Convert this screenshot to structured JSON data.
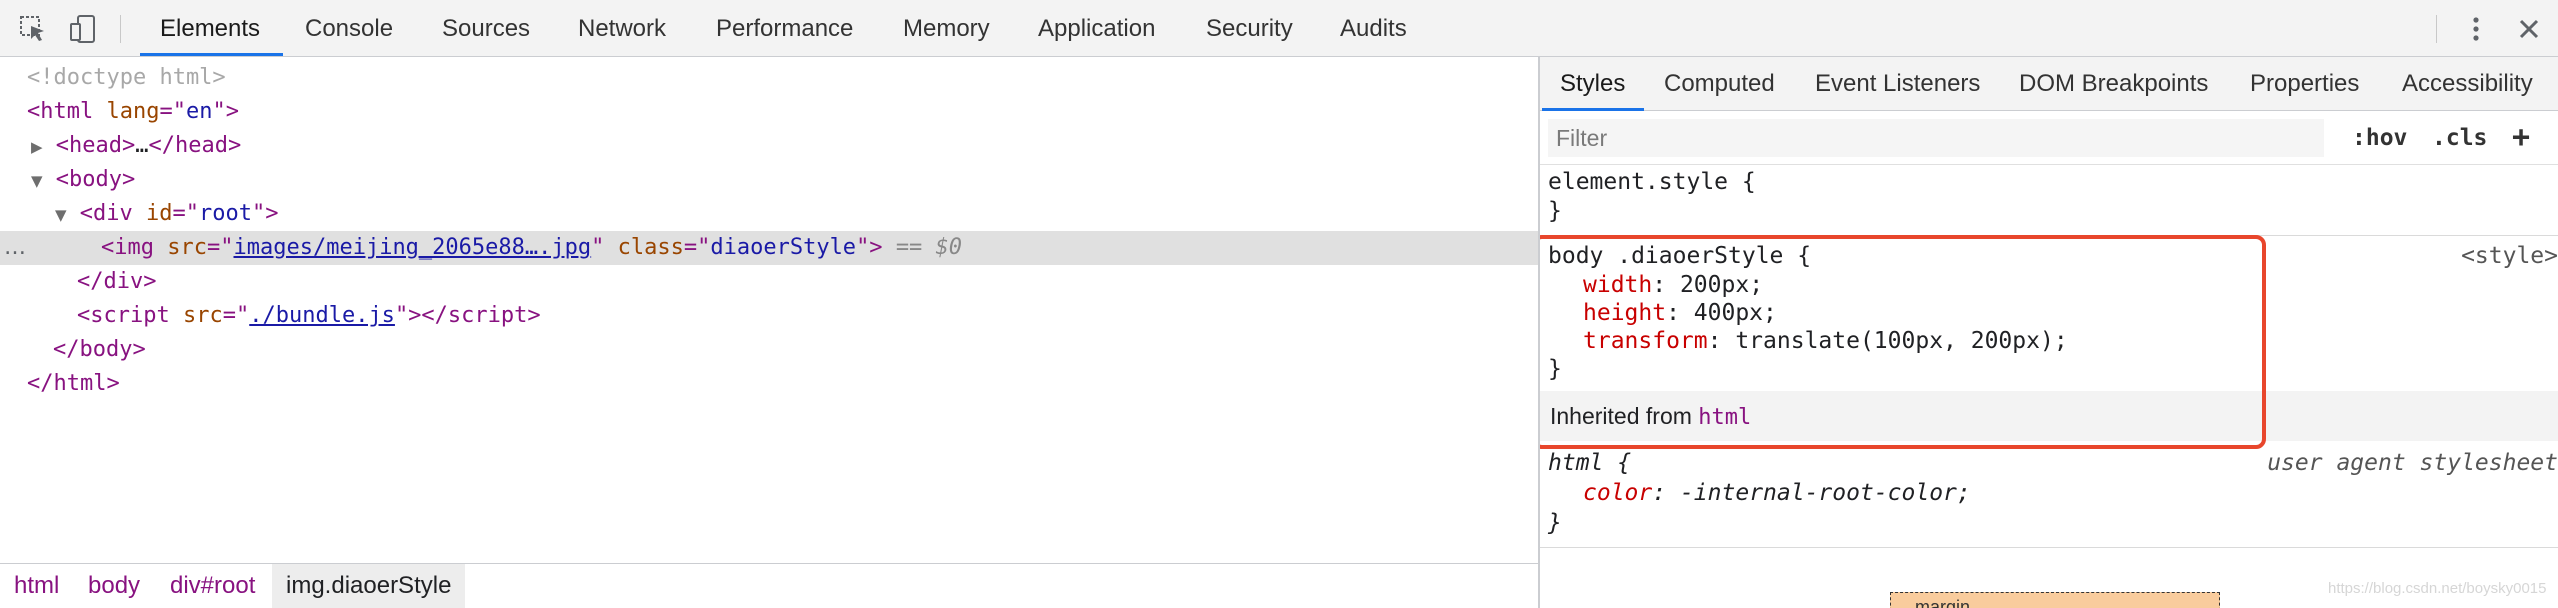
{
  "toolbar": {
    "tabs": [
      "Elements",
      "Console",
      "Sources",
      "Network",
      "Performance",
      "Memory",
      "Application",
      "Security",
      "Audits"
    ],
    "active_tab": "Elements",
    "left_icons": [
      "select-element-icon",
      "device-toolbar-icon"
    ],
    "right_icons": [
      "more-options-icon",
      "close-icon"
    ]
  },
  "dom": {
    "doctype": "<!doctype html>",
    "html_tag": "html",
    "html_attr": "lang",
    "html_lang": "en",
    "head_tag": "head",
    "ellipsis": "…",
    "body_tag": "body",
    "div_tag": "div",
    "div_attr": "id",
    "div_id": "root",
    "img_tag": "img",
    "img_src_attr": "src",
    "img_src": "images/meijing_2065e88….jpg",
    "img_class_attr": "class",
    "img_class": "diaoerStyle",
    "selected_marker": "== $0",
    "script_tag": "script",
    "script_src_attr": "src",
    "script_src": "./bundle.js",
    "row_dots": "…"
  },
  "breadcrumb": [
    "html",
    "body",
    "div#root",
    "img.diaoerStyle"
  ],
  "styles_pane": {
    "tabs": [
      "Styles",
      "Computed",
      "Event Listeners",
      "DOM Breakpoints",
      "Properties",
      "Accessibility"
    ],
    "active_tab": "Styles",
    "filter_placeholder": "Filter",
    "hov_label": ":hov",
    "cls_label": ".cls",
    "add_label": "+",
    "element_style_selector": "element.style {",
    "close_brace": "}",
    "rule": {
      "selector": "body .diaoerStyle {",
      "source": "<style>",
      "declarations": [
        {
          "name": "width",
          "value": "200px"
        },
        {
          "name": "height",
          "value": "400px"
        },
        {
          "name": "transform",
          "value": "translate(100px, 200px)"
        }
      ]
    },
    "inherited_label": "Inherited from",
    "inherited_tag": "html",
    "ua_rule": {
      "selector": "html {",
      "source": "user agent stylesheet",
      "declaration_name": "color",
      "declaration_value": "-internal-root-color"
    },
    "box_model_label": "margin"
  },
  "watermark": "https://blog.csdn.net/boysky0015",
  "colors": {
    "highlight_border": "#e8462c",
    "active_tab_underline": "#1a73e8",
    "tag": "#881280",
    "attribute": "#994500",
    "attribute_value": "#1a1aa6",
    "css_property": "#c80000"
  }
}
